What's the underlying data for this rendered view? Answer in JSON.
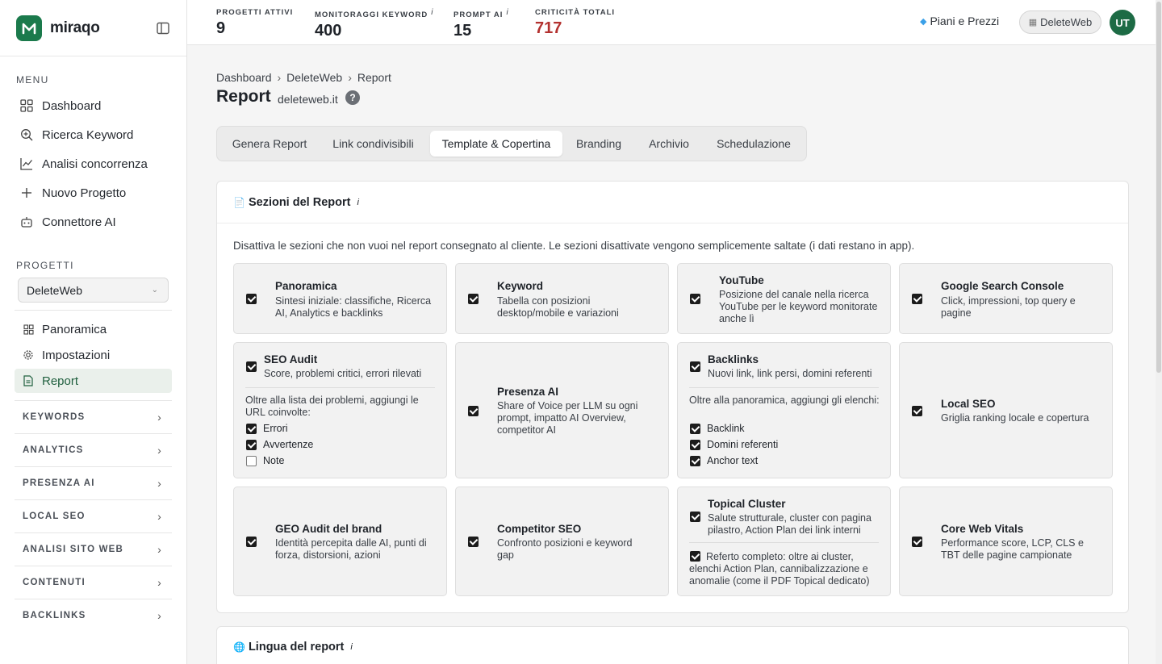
{
  "brand": {
    "name": "miraqo"
  },
  "sidebar": {
    "menu_label": "MENU",
    "menu_items": [
      {
        "label": "Dashboard",
        "icon": "grid-icon"
      },
      {
        "label": "Ricerca Keyword",
        "icon": "search-plus-icon"
      },
      {
        "label": "Analisi concorrenza",
        "icon": "line-chart-icon"
      },
      {
        "label": "Nuovo Progetto",
        "icon": "plus-icon"
      },
      {
        "label": "Connettore AI",
        "icon": "robot-icon"
      }
    ],
    "projects_label": "PROGETTI",
    "project_selected": "DeleteWeb",
    "project_items": [
      {
        "label": "Panoramica",
        "icon": "grid-small-icon"
      },
      {
        "label": "Impostazioni",
        "icon": "gear-icon"
      },
      {
        "label": "Report",
        "icon": "document-icon"
      }
    ],
    "groups": [
      "KEYWORDS",
      "ANALYTICS",
      "PRESENZA AI",
      "LOCAL SEO",
      "ANALISI SITO WEB",
      "CONTENUTI",
      "BACKLINKS"
    ]
  },
  "topbar": {
    "stats": [
      {
        "label": "PROGETTI ATTIVI",
        "value": "9",
        "info": ""
      },
      {
        "label": "MONITORAGGI KEYWORD",
        "value": "400",
        "info": "i"
      },
      {
        "label": "PROMPT AI",
        "value": "15",
        "info": "i"
      },
      {
        "label": "CRITICITÀ TOTALI",
        "value": "717",
        "info": ""
      }
    ],
    "plans_label": "Piani e Prezzi",
    "account_label": "DeleteWeb",
    "avatar_initials": "UT"
  },
  "breadcrumb": [
    "Dashboard",
    "DeleteWeb",
    "Report"
  ],
  "breadcrumb_sep": "›",
  "page": {
    "title": "Report",
    "domain": "deleteweb.it",
    "help": "?"
  },
  "tabs": [
    {
      "label": "Genera Report"
    },
    {
      "label": "Link condivisibili"
    },
    {
      "label": "Template & Copertina"
    },
    {
      "label": "Branding"
    },
    {
      "label": "Archivio"
    },
    {
      "label": "Schedulazione"
    }
  ],
  "sections_card": {
    "title": "Sezioni del Report",
    "info": "i",
    "description": "Disattiva le sezioni che non vuoi nel report consegnato al cliente. Le sezioni disattivate vengono semplicemente saltate (i dati restano in app).",
    "sections": [
      {
        "title": "Panoramica",
        "desc": "Sintesi iniziale: classifiche, Ricerca AI, Analytics e backlinks",
        "checked": true
      },
      {
        "title": "Keyword",
        "desc": "Tabella con posizioni desktop/mobile e variazioni",
        "checked": true
      },
      {
        "title": "YouTube",
        "desc": "Posizione del canale nella ricerca YouTube per le keyword monitorate anche lì",
        "checked": true
      },
      {
        "title": "Google Search Console",
        "desc": "Click, impressioni, top query e pagine",
        "checked": true
      },
      {
        "title": "SEO Audit",
        "desc": "Score, problemi critici, errori rilevati",
        "checked": true,
        "note": "Oltre alla lista dei problemi, aggiungi le URL coinvolte:",
        "options": [
          {
            "label": "Errori",
            "checked": true
          },
          {
            "label": "Avvertenze",
            "checked": true
          },
          {
            "label": "Note",
            "checked": false
          }
        ]
      },
      {
        "title": "Presenza AI",
        "desc": "Share of Voice per LLM su ogni prompt, impatto AI Overview, competitor AI",
        "checked": true
      },
      {
        "title": "Backlinks",
        "desc": "Nuovi link, link persi, domini referenti",
        "checked": true,
        "note": "Oltre alla panoramica, aggiungi gli elenchi:",
        "options": [
          {
            "label": "Backlink",
            "checked": true
          },
          {
            "label": "Domini referenti",
            "checked": true
          },
          {
            "label": "Anchor text",
            "checked": true
          }
        ]
      },
      {
        "title": "Local SEO",
        "desc": "Griglia ranking locale e copertura",
        "checked": true
      },
      {
        "title": "GEO Audit del brand",
        "desc": "Identità percepita dalle AI, punti di forza, distorsioni, azioni",
        "checked": true
      },
      {
        "title": "Competitor SEO",
        "desc": "Confronto posizioni e keyword gap",
        "checked": true
      },
      {
        "title": "Topical Cluster",
        "desc": "Salute strutturale, cluster con pagina pilastro, Action Plan dei link interni",
        "checked": true,
        "extra": "Referto completo: oltre ai cluster, elenchi Action Plan, cannibalizzazione e anomalie (come il PDF Topical dedicato)",
        "extra_checked": true
      },
      {
        "title": "Core Web Vitals",
        "desc": "Performance score, LCP, CLS e TBT delle pagine campionate",
        "checked": true
      }
    ]
  },
  "language_card": {
    "title": "Lingua del report",
    "info": "i"
  },
  "colors": {
    "brand": "#1b7a4c",
    "critical": "#b3312f",
    "avatar": "#1d6b45"
  }
}
